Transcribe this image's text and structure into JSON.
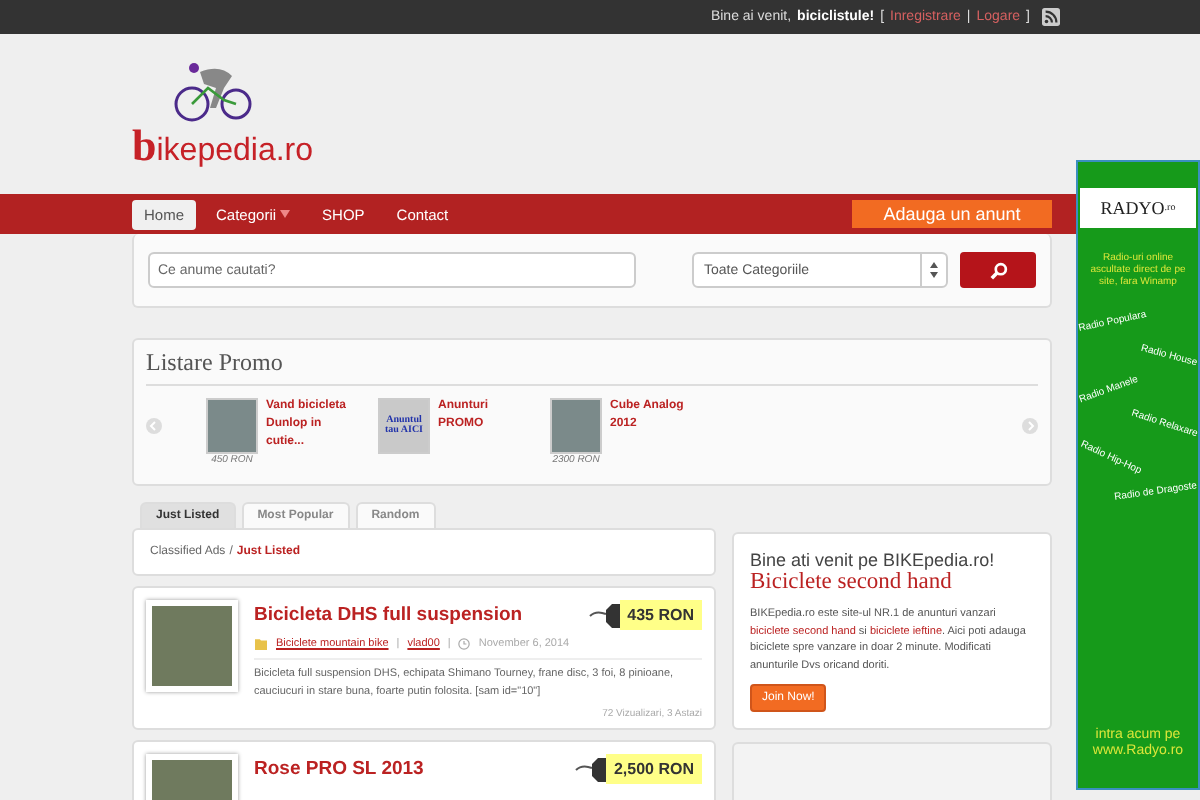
{
  "top_bar": {
    "greeting": "Bine ai venit,",
    "username": "biciclistule!",
    "open": "[",
    "separator": "|",
    "close": "]",
    "links": [
      "Inregistrare",
      "Logare"
    ]
  },
  "logo": {
    "initial": "b",
    "rest": "ikepedia.ro"
  },
  "nav": {
    "items": [
      {
        "label": "Home",
        "selected": true,
        "has_dropdown": false
      },
      {
        "label": "Categorii",
        "selected": false,
        "has_dropdown": true
      },
      {
        "label": "SHOP",
        "selected": false,
        "has_dropdown": false
      },
      {
        "label": "Contact",
        "selected": false,
        "has_dropdown": false
      }
    ],
    "cta": "Adauga un anunt"
  },
  "search": {
    "placeholder": "Ce anume cautati?",
    "category": "Toate Categoriile"
  },
  "promo": {
    "title": "Listare Promo",
    "items": [
      {
        "kind": "photo",
        "title": "Vand bicicleta Dunlop in cutie...",
        "price": "450 RON"
      },
      {
        "kind": "text",
        "thumb_text": "Anuntul tau AICI",
        "title": "Anunturi PROMO"
      },
      {
        "kind": "photo",
        "title": "Cube Analog 2012",
        "price": "2300 RON"
      }
    ]
  },
  "tabs": [
    {
      "label": "Just Listed",
      "selected": true
    },
    {
      "label": "Most Popular",
      "selected": false
    },
    {
      "label": "Random",
      "selected": false
    }
  ],
  "breadcrumb": {
    "root": "Classified Ads",
    "separator": "/",
    "current": "Just Listed"
  },
  "listings": [
    {
      "title": "Bicicleta DHS full suspension",
      "price": "435 RON",
      "category": "Biciclete mountain bike",
      "author": "vlad00",
      "meta_separator": "|",
      "date": "November 6, 2014",
      "description": "Bicicleta full suspension DHS, echipata Shimano Tourney, frane disc, 3 foi, 8 pinioane, cauciucuri in stare buna, foarte putin folosita. [sam id=\"10\"]",
      "stats": "72 Vizualizari, 3 Astazi"
    },
    {
      "title": "Rose PRO SL 2013",
      "price": "2,500 RON"
    }
  ],
  "welcome": {
    "heading": "Bine ati venit pe BIKEpedia.ro!",
    "subtitle": "Biciclete second hand",
    "body": [
      {
        "text": "BIKEpedia.ro este site-ul NR.1 de anunturi vanzari ",
        "link": false
      },
      {
        "text": "biciclete second hand",
        "link": true
      },
      {
        "text": " si ",
        "link": false
      },
      {
        "text": "biciclete ieftine",
        "link": true
      },
      {
        "text": ". Aici poti adauga biciclete spre vanzare in doar 2 minute. Modificati anunturile Dvs oricand doriti.",
        "link": false
      }
    ],
    "button": "Join Now!"
  },
  "radio": {
    "logo": "RADYO",
    "logo_suffix": ".ro",
    "intro": "Radio-uri online ascultate direct de pe site, fara Winamp",
    "stations": [
      "Radio Populara",
      "Radio House",
      "Radio Manele",
      "Radio Relaxare",
      "Radio Hip-Hop",
      "Radio de Dragoste"
    ],
    "footer": "intra acum pe www.Radyo.ro"
  }
}
